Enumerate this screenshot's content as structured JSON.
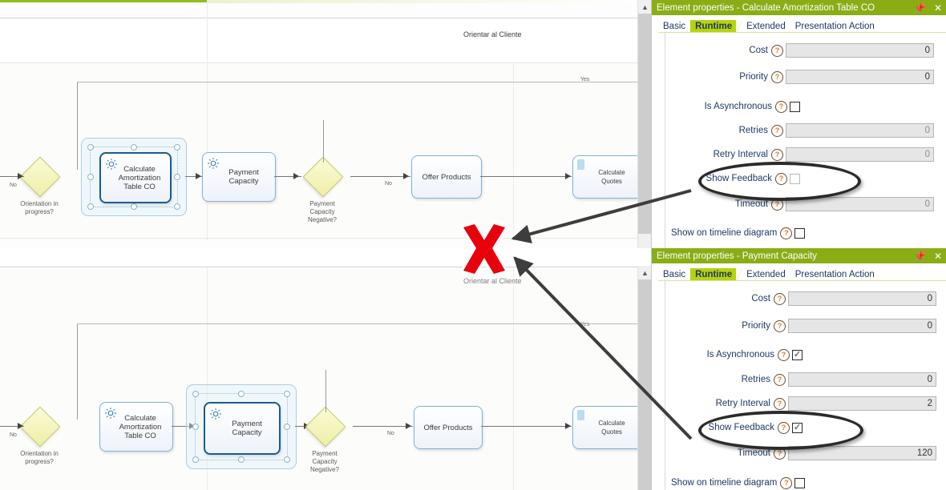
{
  "diagram": {
    "lane_label": "Orientar al Cliente",
    "tasks": {
      "calc_amort": "Calculate\nAmortization\nTable CO",
      "payment_capacity": "Payment\nCapacity",
      "offer_products": "Offer Products",
      "calculate_quotes": "Calculate\nQuotes"
    },
    "gateways": {
      "orientation": "Orientation in\nprogress?",
      "payment_negative": "Payment\nCapacity\nNegative?"
    },
    "edge_labels": {
      "no_left": "No",
      "yes_top": "Yes",
      "no_mid": "No"
    },
    "icons": {
      "task_icon": "gear-icon",
      "doc_icon": "document-icon"
    }
  },
  "annotations": {
    "error_mark": "red-x-mark",
    "arrow_icon": "arrow-icon"
  },
  "panels": [
    {
      "id": "panel-calculate-amortization",
      "title": "Element properties - Calculate Amortization Table CO",
      "pin_icon": "pin-icon",
      "close_icon": "close-icon",
      "scroll_up_icon": "chevron-up-icon",
      "tabs": [
        {
          "label": "Basic",
          "active": false
        },
        {
          "label": "Runtime",
          "active": true
        },
        {
          "label": "Extended",
          "active": false
        },
        {
          "label": "Presentation Action",
          "active": false
        }
      ],
      "fields": [
        {
          "label": "Cost",
          "type": "text",
          "value": "0",
          "dim": false
        },
        {
          "label": "Priority",
          "type": "text",
          "value": "0",
          "dim": false
        },
        {
          "label": "Is Asynchronous",
          "type": "checkbox",
          "checked": false
        },
        {
          "label": "Retries",
          "type": "text",
          "value": "0",
          "dim": true
        },
        {
          "label": "Retry Interval",
          "type": "text",
          "value": "0",
          "dim": true
        },
        {
          "label": "Show Feedback",
          "type": "checkbox",
          "checked": false
        },
        {
          "label": "Timeout",
          "type": "text",
          "value": "0",
          "dim": true
        },
        {
          "label": "Show on timeline diagram",
          "type": "checkbox",
          "checked": false
        }
      ]
    },
    {
      "id": "panel-payment-capacity",
      "title": "Element properties - Payment Capacity",
      "pin_icon": "pin-icon",
      "close_icon": "close-icon",
      "scroll_up_icon": "chevron-up-icon",
      "tabs": [
        {
          "label": "Basic",
          "active": false
        },
        {
          "label": "Runtime",
          "active": true
        },
        {
          "label": "Extended",
          "active": false
        },
        {
          "label": "Presentation Action",
          "active": false
        }
      ],
      "fields": [
        {
          "label": "Cost",
          "type": "text",
          "value": "0",
          "dim": false
        },
        {
          "label": "Priority",
          "type": "text",
          "value": "0",
          "dim": false
        },
        {
          "label": "Is Asynchronous",
          "type": "checkbox",
          "checked": true
        },
        {
          "label": "Retries",
          "type": "text",
          "value": "0",
          "dim": false
        },
        {
          "label": "Retry Interval",
          "type": "text",
          "value": "2",
          "dim": false
        },
        {
          "label": "Show Feedback",
          "type": "checkbox",
          "checked": true
        },
        {
          "label": "Timeout",
          "type": "text",
          "value": "120",
          "dim": false
        },
        {
          "label": "Show on timeline diagram",
          "type": "checkbox",
          "checked": false
        }
      ]
    }
  ],
  "colors": {
    "title_green": "#8aad16",
    "tab_active": "#b5d40d",
    "label_navy": "#1f3864",
    "help_orange": "#e07b16",
    "error_red": "#e8000d"
  }
}
